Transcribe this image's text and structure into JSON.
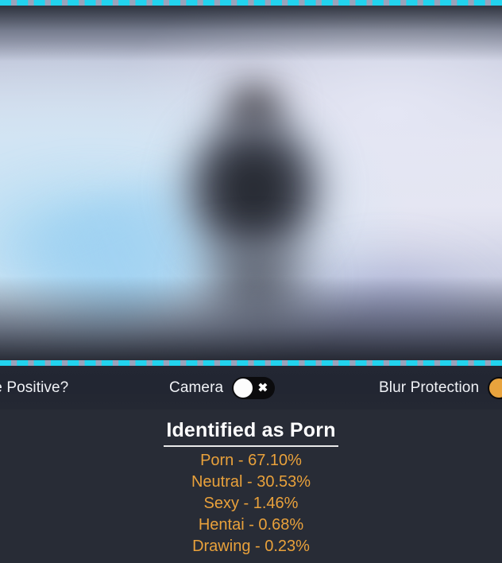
{
  "video": {
    "state_label": "blurred-camera-feed",
    "border_color": "#22d3ee"
  },
  "controls": {
    "false_positive": {
      "label": "Positive?",
      "full_label": "False Positive?"
    },
    "camera": {
      "label": "Camera",
      "toggle_state": "off",
      "toggle_glyph": "✖",
      "knob_color": "#fdfdfd",
      "track_color": "#0b0b0d"
    },
    "blur_protection": {
      "label": "Blur Protection",
      "toggle_state": "on",
      "knob_color": "#e8a33d",
      "track_color": "#0b0b0d"
    }
  },
  "results": {
    "verdict": "Identified as Porn",
    "accent_color": "#e9a13b",
    "scores": [
      {
        "line": "Porn - 67.10%",
        "label": "Porn",
        "value": 67.1
      },
      {
        "line": "Neutral - 30.53%",
        "label": "Neutral",
        "value": 30.53
      },
      {
        "line": "Sexy - 1.46%",
        "label": "Sexy",
        "value": 1.46
      },
      {
        "line": "Hentai - 0.68%",
        "label": "Hentai",
        "value": 0.68
      },
      {
        "line": "Drawing - 0.23%",
        "label": "Drawing",
        "value": 0.23
      }
    ]
  }
}
